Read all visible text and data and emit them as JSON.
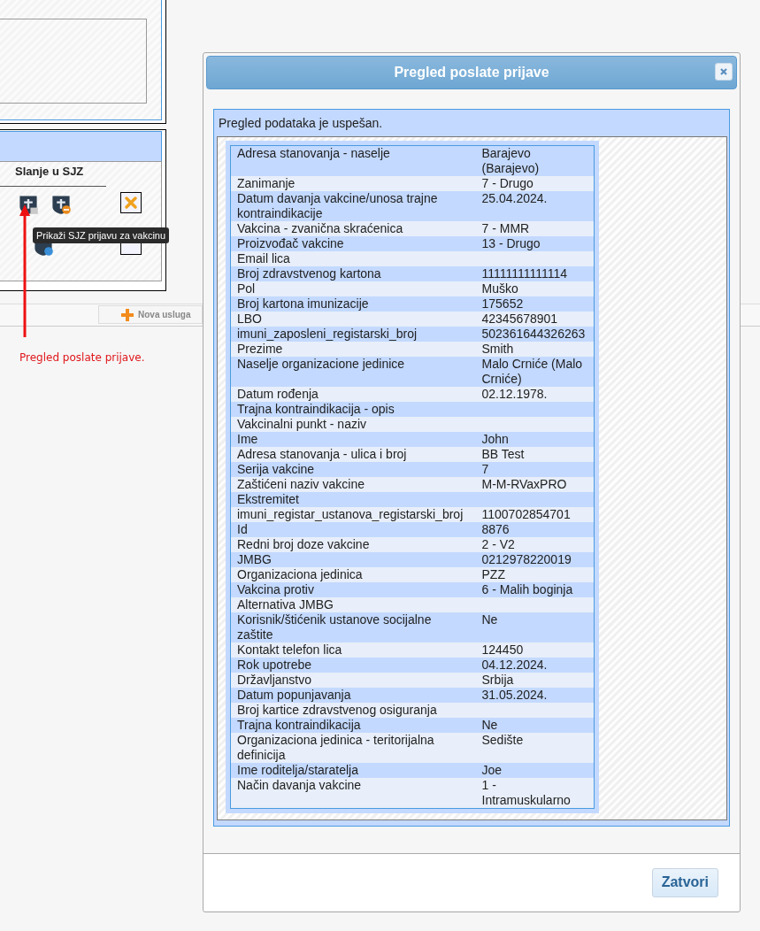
{
  "background": {
    "column_header": "Slanje u SJZ",
    "tooltip": "Prikaži SJZ prijavu za vakcinu",
    "toolbar_button": "Nova usluga",
    "annotation": "Pregled poslate prijave."
  },
  "dialog": {
    "title": "Pregled poslate prijave",
    "message": "Pregled podataka je uspešan.",
    "rows": [
      {
        "label": "Adresa stanovanja - naselje",
        "value": "Barajevo (Barajevo)"
      },
      {
        "label": "Zanimanje",
        "value": "7 - Drugo"
      },
      {
        "label": "Datum davanja vakcine/unosa trajne kontraindikacije",
        "value": "25.04.2024."
      },
      {
        "label": "Vakcina - zvanična skraćenica",
        "value": "7 - MMR"
      },
      {
        "label": "Proizvođač vakcine",
        "value": "13 - Drugo"
      },
      {
        "label": "Email lica",
        "value": ""
      },
      {
        "label": "Broj zdravstvenog kartona",
        "value": "11111111111114"
      },
      {
        "label": "Pol",
        "value": "Muško"
      },
      {
        "label": "Broj kartona imunizacije",
        "value": "175652"
      },
      {
        "label": "LBO",
        "value": "42345678901"
      },
      {
        "label": "imuni_zaposleni_registarski_broj",
        "value": "502361644326263"
      },
      {
        "label": "Prezime",
        "value": "Smith"
      },
      {
        "label": "Naselje organizacione jedinice",
        "value": "Malo Crniće (Malo Crniće)"
      },
      {
        "label": "Datum rođenja",
        "value": "02.12.1978."
      },
      {
        "label": "Trajna kontraindikacija - opis",
        "value": ""
      },
      {
        "label": "Vakcinalni punkt - naziv",
        "value": ""
      },
      {
        "label": "Ime",
        "value": "John"
      },
      {
        "label": "Adresa stanovanja - ulica i broj",
        "value": "BB Test"
      },
      {
        "label": "Serija vakcine",
        "value": "7"
      },
      {
        "label": "Zaštićeni naziv vakcine",
        "value": "M-M-RVaxPRO"
      },
      {
        "label": "Ekstremitet",
        "value": ""
      },
      {
        "label": "imuni_registar_ustanova_registarski_broj",
        "value": "1100702854701"
      },
      {
        "label": "Id",
        "value": "8876"
      },
      {
        "label": "Redni broj doze vakcine",
        "value": "2 - V2"
      },
      {
        "label": "JMBG",
        "value": "0212978220019"
      },
      {
        "label": "Organizaciona jedinica",
        "value": "PZZ"
      },
      {
        "label": "Vakcina protiv",
        "value": "6 - Malih boginja"
      },
      {
        "label": "Alternativa JMBG",
        "value": ""
      },
      {
        "label": "Korisnik/štićenik ustanove socijalne zaštite",
        "value": "Ne"
      },
      {
        "label": "Kontakt telefon lica",
        "value": "124450"
      },
      {
        "label": "Rok upotrebe",
        "value": "04.12.2024."
      },
      {
        "label": "Državljanstvo",
        "value": "Srbija"
      },
      {
        "label": "Datum popunjavanja",
        "value": "31.05.2024."
      },
      {
        "label": "Broj kartice zdravstvenog osiguranja",
        "value": ""
      },
      {
        "label": "Trajna kontraindikacija",
        "value": "Ne"
      },
      {
        "label": "Organizaciona jedinica - teritorijalna definicija",
        "value": "Sedište"
      },
      {
        "label": "Ime roditelja/staratelja",
        "value": "Joe"
      },
      {
        "label": "Način davanja vakcine",
        "value": "1 - Intramuskularno"
      }
    ],
    "button": "Zatvori"
  }
}
